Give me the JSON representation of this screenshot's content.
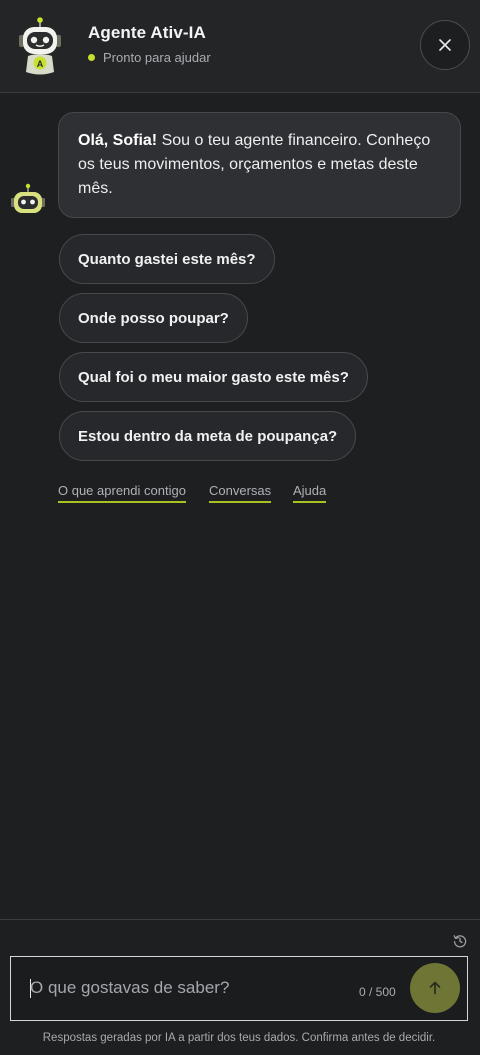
{
  "header": {
    "title": "Agente Ativ-IA",
    "status": "Pronto para ajudar",
    "close_icon": "close-icon"
  },
  "message": {
    "greeting": "Olá, Sofia!",
    "text": " Sou o teu agente financeiro. Conheço os teus movimentos, orçamentos e metas deste mês."
  },
  "suggestions": [
    "Quanto gastei este mês?",
    "Onde posso poupar?",
    "Qual foi o meu maior gasto este mês?",
    "Estou dentro da meta de poupança?"
  ],
  "links": [
    "O que aprendi contigo",
    "Conversas",
    "Ajuda"
  ],
  "composer": {
    "placeholder": "O que gostavas de saber?",
    "value": "",
    "counter": "0 / 500",
    "send_icon": "arrow-up-icon",
    "history_icon": "history-icon"
  },
  "disclaimer": "Respostas geradas por IA a partir dos teus dados. Confirma antes de decidir.",
  "colors": {
    "background": "#1d1f21",
    "accent": "#c7e12e",
    "send_button": "#6f7534"
  }
}
